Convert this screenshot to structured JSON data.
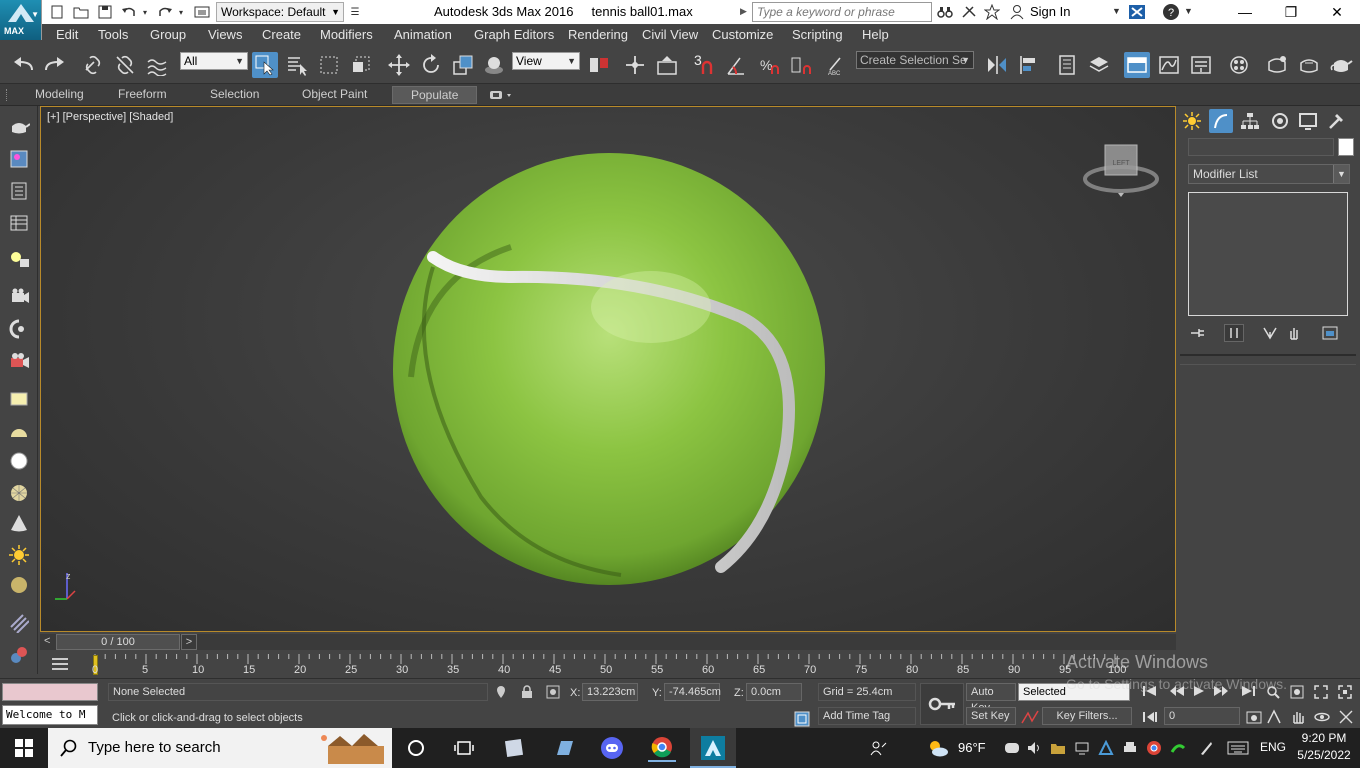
{
  "titlebar": {
    "workspace": "Workspace: Default",
    "app_name": "Autodesk 3ds Max 2016",
    "file_name": "tennis ball01.max",
    "search_placeholder": "Type a keyword or phrase",
    "sign_in": "Sign In",
    "logo_label": "MAX"
  },
  "menu": [
    "Edit",
    "Tools",
    "Group",
    "Views",
    "Create",
    "Modifiers",
    "Animation",
    "Graph Editors",
    "Rendering",
    "Civil View",
    "Customize",
    "Scripting",
    "Help"
  ],
  "toolbar": {
    "selection_filter": "All",
    "ref_coord": "View",
    "named_selection": "Create Selection Se",
    "snap_label": "3"
  },
  "ribbon": {
    "tabs": [
      "Modeling",
      "Freeform",
      "Selection",
      "Object Paint",
      "Populate"
    ],
    "active": "Populate"
  },
  "viewport": {
    "label": "[+] [Perspective] [Shaded]",
    "viewcube_face": "LEFT",
    "axis_label": "z"
  },
  "command_panel": {
    "modifier_list": "Modifier List"
  },
  "timeline": {
    "frame_display": "0 / 100",
    "ticks": [
      "0",
      "5",
      "10",
      "15",
      "20",
      "25",
      "30",
      "35",
      "40",
      "45",
      "50",
      "55",
      "60",
      "65",
      "70",
      "75",
      "80",
      "85",
      "90",
      "95",
      "100"
    ]
  },
  "status": {
    "selection": "None Selected",
    "prompt": "Click or click-and-drag to select objects",
    "x_label": "X:",
    "x_value": "13.223cm",
    "y_label": "Y:",
    "y_value": "-74.465cm",
    "z_label": "Z:",
    "z_value": "0.0cm",
    "grid": "Grid = 25.4cm",
    "add_time_tag": "Add Time Tag",
    "auto_key": "Auto Key",
    "set_key": "Set Key",
    "key_mode": "Selected",
    "key_filters": "Key Filters...",
    "current_frame": "0",
    "maxscript": "Welcome to M"
  },
  "watermark": {
    "line1": "Activate Windows",
    "line2": "Go to Settings to activate Windows."
  },
  "taskbar": {
    "search_placeholder": "Type here to search",
    "temperature": "96°F",
    "language": "ENG",
    "time": "9:20 PM",
    "date": "5/25/2022"
  },
  "colors": {
    "ball_green": "#8fc240",
    "viewport_border": "#b88a2a",
    "selected_blue": "#4f90c8"
  }
}
